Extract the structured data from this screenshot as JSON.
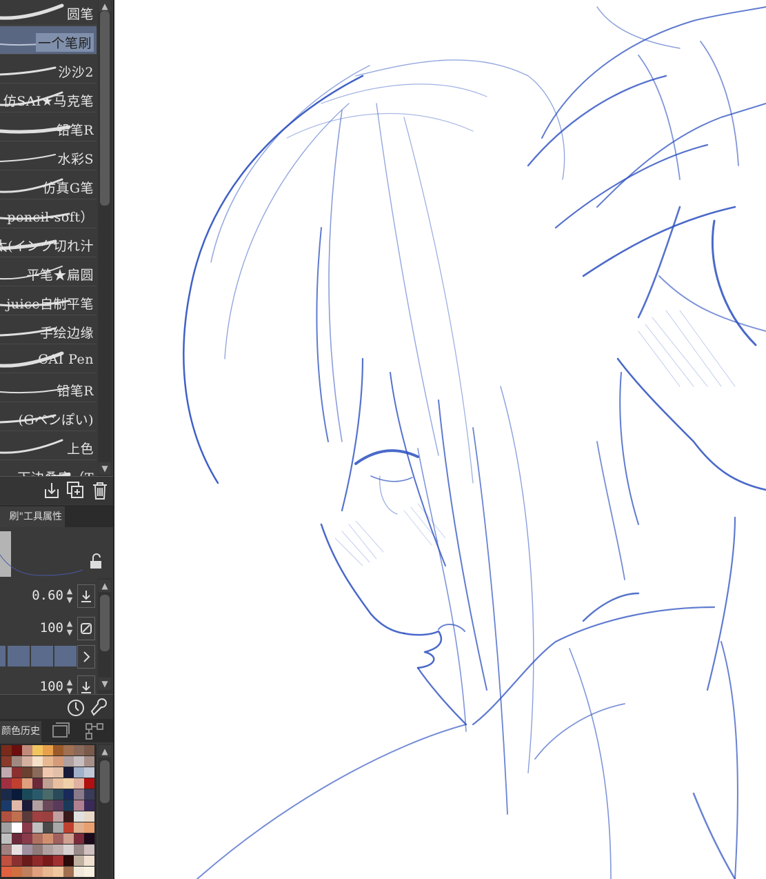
{
  "brush_list": {
    "items": [
      {
        "name": "圆笔",
        "selected": false
      },
      {
        "name": "一个笔刷",
        "selected": true
      },
      {
        "name": "沙沙2",
        "selected": false
      },
      {
        "name": "仿SAI★马克笔",
        "selected": false
      },
      {
        "name": "铅笔R",
        "selected": false
      },
      {
        "name": "水彩S",
        "selected": false
      },
      {
        "name": "仿真G笔",
        "selected": false
      },
      {
        "name": "pencil-soft）",
        "selected": false
      },
      {
        "name": "太(インク切れ汁",
        "selected": false
      },
      {
        "name": "平笔★扁圆",
        "selected": false
      },
      {
        "name": "juice自制平笔",
        "selected": false
      },
      {
        "name": "手绘边缘",
        "selected": false
      },
      {
        "name": "CAI Pen",
        "selected": false
      },
      {
        "name": "铅笔R",
        "selected": false
      },
      {
        "name": "(Gペンぽい)",
        "selected": false
      },
      {
        "name": "上色",
        "selected": false
      },
      {
        "name": "下边叠底（T",
        "selected": false
      }
    ]
  },
  "brush_toolbar": {
    "icons": [
      "import-brush-icon",
      "duplicate-brush-icon",
      "delete-brush-icon"
    ]
  },
  "tool_property": {
    "tab_label": "刷\"工具属性",
    "lock_icon": "unlock-icon",
    "rows": [
      {
        "value": "0.60",
        "button_icon": "download-icon"
      },
      {
        "value": "100",
        "button_icon": "no-entry-icon"
      },
      {
        "value": "",
        "button_icon": "chevron-right-icon"
      },
      {
        "value": "100",
        "button_icon": "download-icon"
      }
    ],
    "footer_icons": [
      "timer-icon",
      "wrench-icon"
    ]
  },
  "color_panel": {
    "tab_label": "颜色历史",
    "tab_icons": [
      "layer-window-icon",
      "node-tree-icon"
    ],
    "swatches": [
      "#7a2a1a",
      "#6b0e0e",
      "#c28a7a",
      "#f2c45e",
      "#e8a04a",
      "#9a5a2a",
      "#a07050",
      "#8a6a5a",
      "#7a5a4a",
      "#8a3a2a",
      "#a08a80",
      "#d4b0a0",
      "#f5e0c8",
      "#e8b890",
      "#d49a7a",
      "#b0a0a0",
      "#c8c0c0",
      "#a8908a",
      "#c0aab0",
      "#8a3030",
      "#6a4030",
      "#8a6a5a",
      "#f0c8b0",
      "#e0c0a8",
      "#1a1a3a",
      "#a0b0c8",
      "#c0c8d8",
      "#a03040",
      "#c04030",
      "#e0a080",
      "#6a2a3a",
      "#c0a090",
      "#e8c0a0",
      "#f0d0a8",
      "#e0b0a0",
      "#b01010",
      "#1a2a4a",
      "#0a1a3a",
      "#1a4a5a",
      "#2a5a6a",
      "#4a6a6a",
      "#2a4a5a",
      "#1a2a5a",
      "#8a7a8a",
      "#3a3a5a",
      "#1a3a6a",
      "#e0b8a8",
      "#1a1a3a",
      "#b0a0a0",
      "#6a4a5a",
      "#5a3a5a",
      "#1a3a5a",
      "#b08090",
      "#3a2a5a",
      "#b05040",
      "#c07050",
      "#5a3a3a",
      "#a04040",
      "#9a4040",
      "#c0a0a0",
      "#3a1a1a",
      "#e0e0e0",
      "#e8d8c8",
      "#a0a0a0",
      "#ffffff",
      "#8a3a4a",
      "#c0c0c0",
      "#4a4a4a",
      "#a8a8a8",
      "#c04030",
      "#e0b090",
      "#e8a070",
      "#c0c0c0",
      "#6a2a3a",
      "#8a3a4a",
      "#b07060",
      "#d09070",
      "#a06060",
      "#d0a090",
      "#7a2a3a",
      "#1a0a1a",
      "#a08080",
      "#e8e0e0",
      "#a090a0",
      "#907a7a",
      "#b0a0a0",
      "#c0b0b0",
      "#d8d0d0",
      "#9a8a8a",
      "#d0c0c0",
      "#c05040",
      "#8a3030",
      "#6a1a1a",
      "#902a2a",
      "#7a1a1a",
      "#a03030",
      "#2a0a0a",
      "#c0b0a0",
      "#f0e0d0",
      "#e06040",
      "#d07040",
      "#c08060",
      "#e0a080",
      "#e8b890",
      "#f0c8a0",
      "#a07050",
      "#f0e8d8",
      "#f8f0e0"
    ]
  },
  "canvas": {
    "background": "#ffffff",
    "stroke_color": "#2a4fbf",
    "content": "line-art-sketch"
  },
  "colors": {
    "panel_bg": "#3a3a3a",
    "selected_item_bg": "#5a6782",
    "accent_blue": "#5b6b8c"
  }
}
